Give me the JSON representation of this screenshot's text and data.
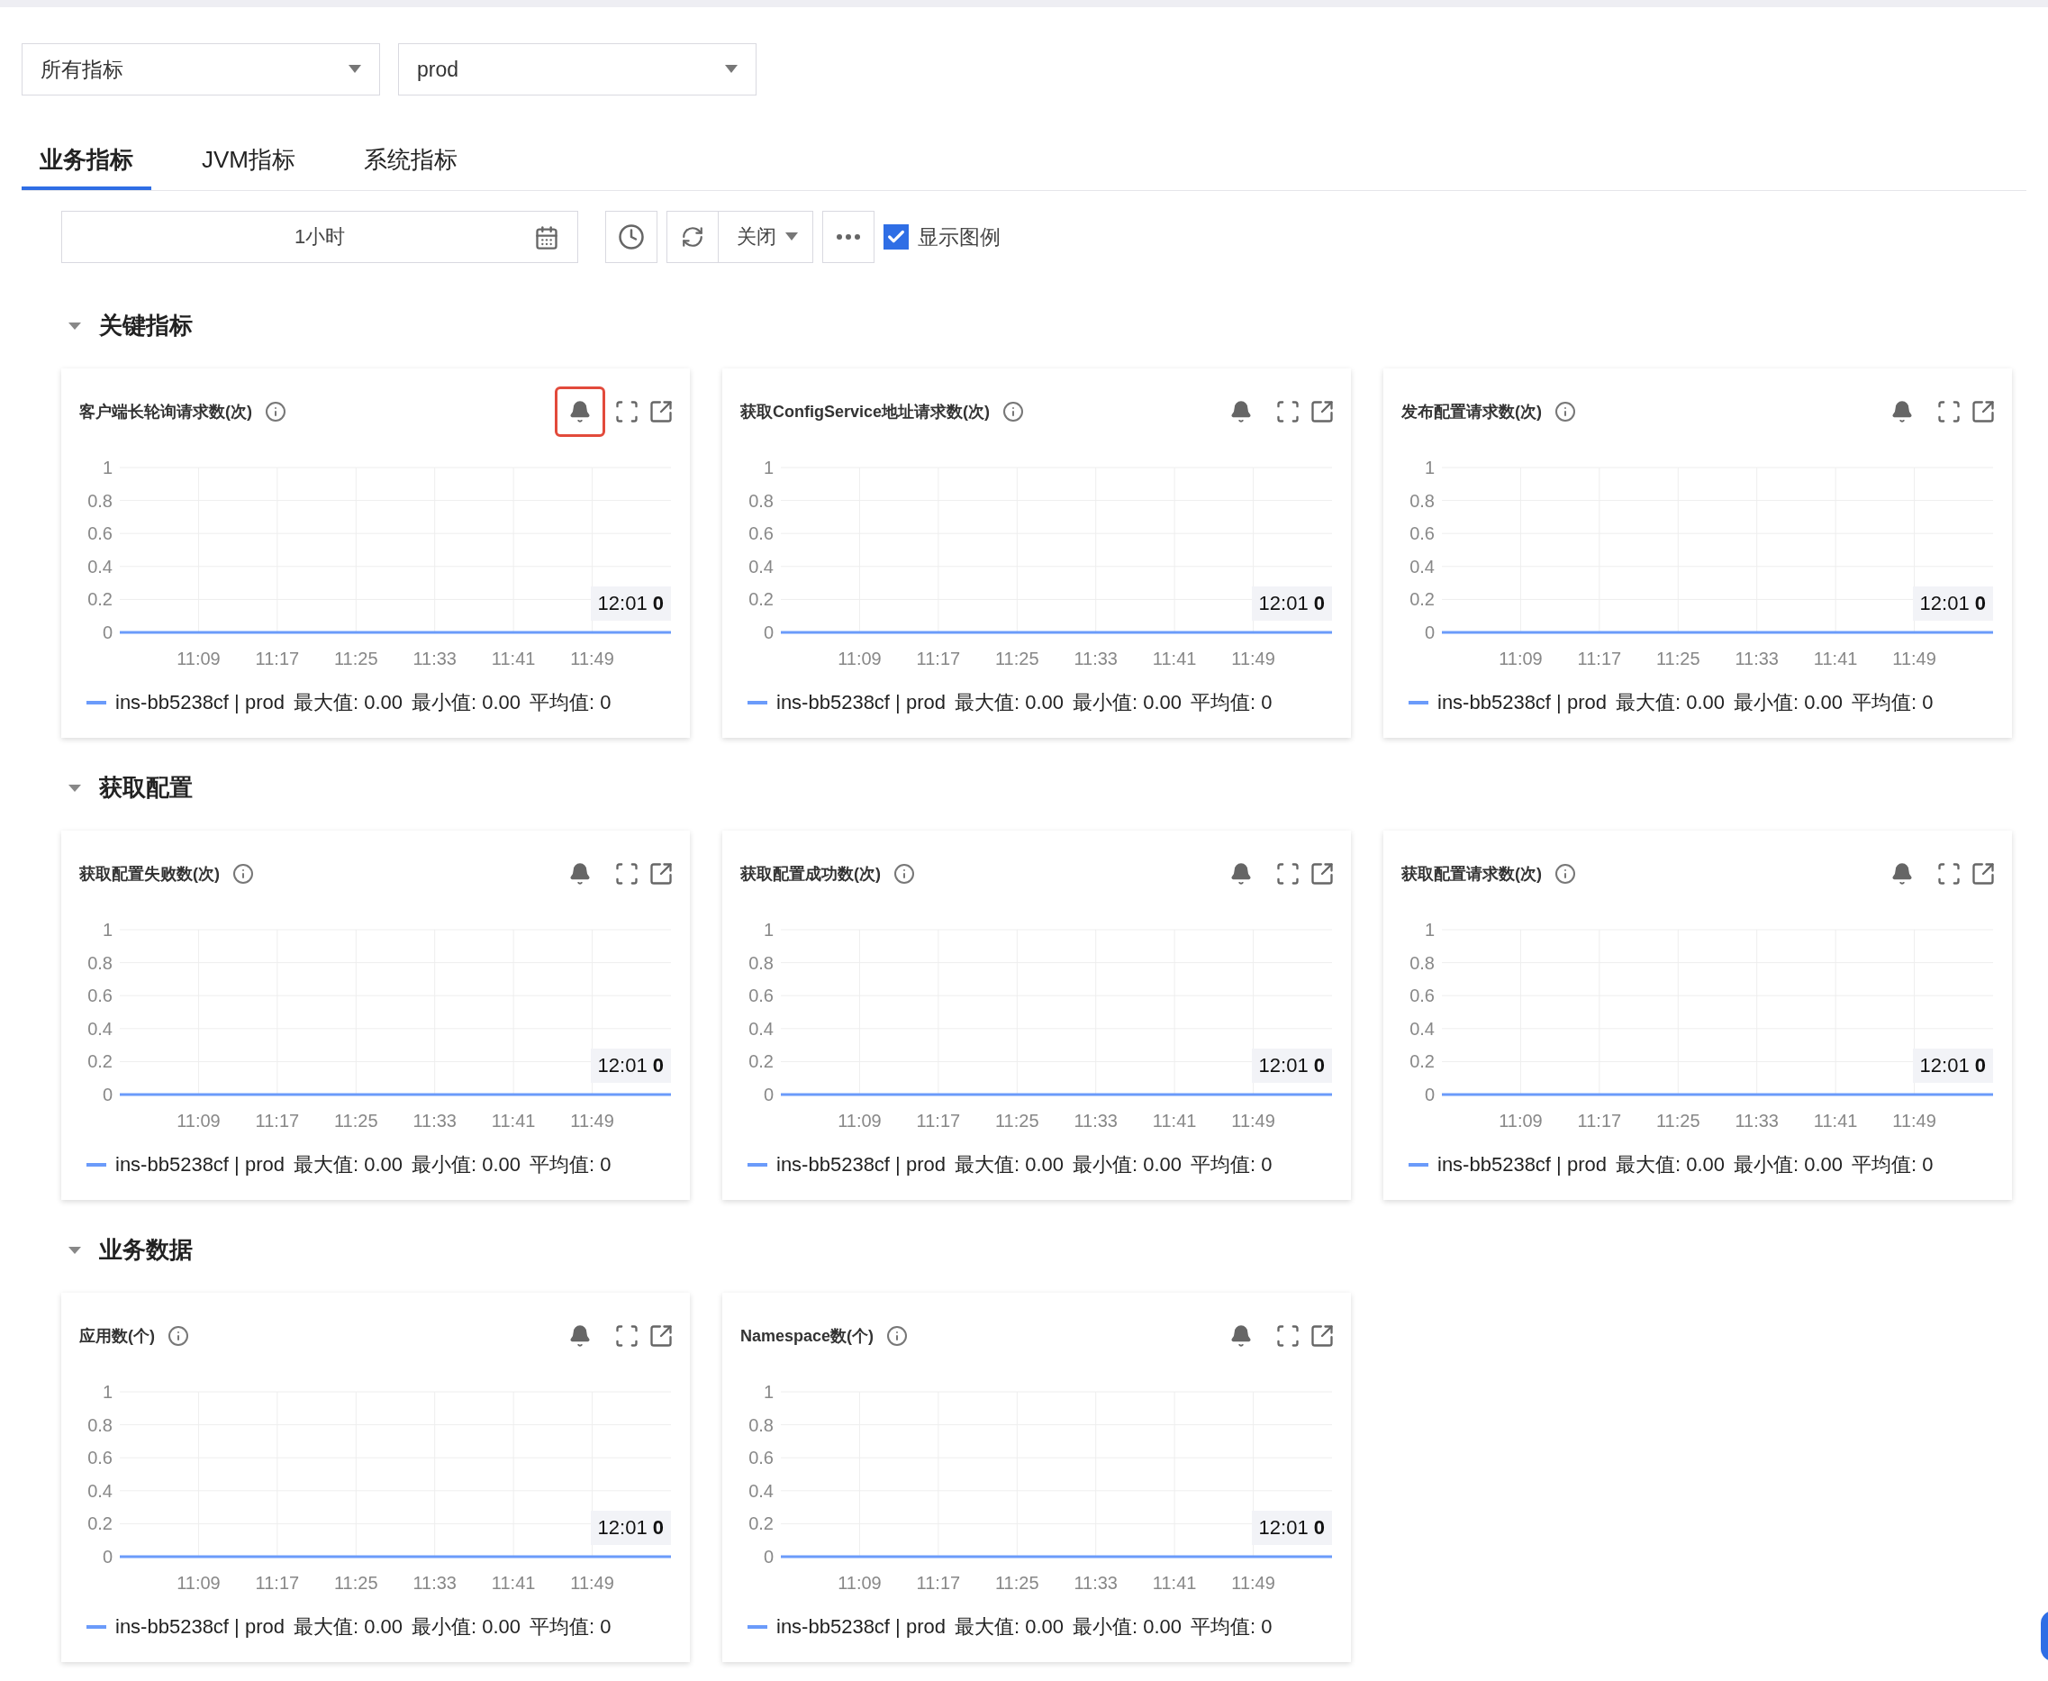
{
  "filters": [
    {
      "value": "所有指标"
    },
    {
      "value": "prod"
    }
  ],
  "tabs": [
    {
      "label": "业务指标",
      "selected": true
    },
    {
      "label": "JVM指标",
      "selected": false
    },
    {
      "label": "系统指标",
      "selected": false
    }
  ],
  "toolbar": {
    "time_range": "1小时",
    "refresh_mode": "关闭",
    "show_legend": {
      "label": "显示图例",
      "checked": true
    }
  },
  "sections": [
    {
      "title": "关键指标",
      "expanded": true,
      "cards": [
        {
          "title": "客户端长轮询请求数(次)",
          "alert_highlighted": true,
          "tooltip": "12:01 **0**",
          "stats": [
            "最大值: 0.00",
            "最小值: 0.00",
            "平均值: 0"
          ],
          "chart_data": {
            "type": "line",
            "grid": true,
            "categories": [
              null,
              "11:09",
              "11:17",
              "11:25",
              "11:33",
              "11:41",
              "11:49",
              null
            ],
            "ylim": [
              0,
              1
            ],
            "yticks": [
              0,
              0.2,
              0.4,
              0.6,
              0.8,
              1
            ],
            "series": [
              {
                "name": "ins-bb5238cf | prod",
                "color": "#6b9bfa",
                "values": [
                  0,
                  0,
                  0,
                  0,
                  0,
                  0,
                  0,
                  0
                ]
              }
            ]
          }
        },
        {
          "title": "获取ConfigService地址请求数(次)",
          "alert_highlighted": false,
          "tooltip": "12:01 **0**",
          "stats": [
            "最大值: 0.00",
            "最小值: 0.00",
            "平均值: 0"
          ],
          "chart_data": {
            "type": "line",
            "grid": true,
            "categories": [
              null,
              "11:09",
              "11:17",
              "11:25",
              "11:33",
              "11:41",
              "11:49",
              null
            ],
            "ylim": [
              0,
              1
            ],
            "yticks": [
              0,
              0.2,
              0.4,
              0.6,
              0.8,
              1
            ],
            "series": [
              {
                "name": "ins-bb5238cf | prod",
                "color": "#6b9bfa",
                "values": [
                  0,
                  0,
                  0,
                  0,
                  0,
                  0,
                  0,
                  0
                ]
              }
            ]
          }
        },
        {
          "title": "发布配置请求数(次)",
          "alert_highlighted": false,
          "tooltip": "12:01 **0**",
          "stats": [
            "最大值: 0.00",
            "最小值: 0.00",
            "平均值: 0"
          ],
          "chart_data": {
            "type": "line",
            "grid": true,
            "categories": [
              null,
              "11:09",
              "11:17",
              "11:25",
              "11:33",
              "11:41",
              "11:49",
              null
            ],
            "ylim": [
              0,
              1
            ],
            "yticks": [
              0,
              0.2,
              0.4,
              0.6,
              0.8,
              1
            ],
            "series": [
              {
                "name": "ins-bb5238cf | prod",
                "color": "#6b9bfa",
                "values": [
                  0,
                  0,
                  0,
                  0,
                  0,
                  0,
                  0,
                  0
                ]
              }
            ]
          }
        }
      ]
    },
    {
      "title": "获取配置",
      "expanded": true,
      "cards": [
        {
          "title": "获取配置失败数(次)",
          "alert_highlighted": false,
          "tooltip": "12:01 **0**",
          "stats": [
            "最大值: 0.00",
            "最小值: 0.00",
            "平均值: 0"
          ],
          "chart_data": {
            "type": "line",
            "grid": true,
            "categories": [
              null,
              "11:09",
              "11:17",
              "11:25",
              "11:33",
              "11:41",
              "11:49",
              null
            ],
            "ylim": [
              0,
              1
            ],
            "yticks": [
              0,
              0.2,
              0.4,
              0.6,
              0.8,
              1
            ],
            "series": [
              {
                "name": "ins-bb5238cf | prod",
                "color": "#6b9bfa",
                "values": [
                  0,
                  0,
                  0,
                  0,
                  0,
                  0,
                  0,
                  0
                ]
              }
            ]
          }
        },
        {
          "title": "获取配置成功数(次)",
          "alert_highlighted": false,
          "tooltip": "12:01 **0**",
          "stats": [
            "最大值: 0.00",
            "最小值: 0.00",
            "平均值: 0"
          ],
          "chart_data": {
            "type": "line",
            "grid": true,
            "categories": [
              null,
              "11:09",
              "11:17",
              "11:25",
              "11:33",
              "11:41",
              "11:49",
              null
            ],
            "ylim": [
              0,
              1
            ],
            "yticks": [
              0,
              0.2,
              0.4,
              0.6,
              0.8,
              1
            ],
            "series": [
              {
                "name": "ins-bb5238cf | prod",
                "color": "#6b9bfa",
                "values": [
                  0,
                  0,
                  0,
                  0,
                  0,
                  0,
                  0,
                  0
                ]
              }
            ]
          }
        },
        {
          "title": "获取配置请求数(次)",
          "alert_highlighted": false,
          "tooltip": "12:01 **0**",
          "stats": [
            "最大值: 0.00",
            "最小值: 0.00",
            "平均值: 0"
          ],
          "chart_data": {
            "type": "line",
            "grid": true,
            "categories": [
              null,
              "11:09",
              "11:17",
              "11:25",
              "11:33",
              "11:41",
              "11:49",
              null
            ],
            "ylim": [
              0,
              1
            ],
            "yticks": [
              0,
              0.2,
              0.4,
              0.6,
              0.8,
              1
            ],
            "series": [
              {
                "name": "ins-bb5238cf | prod",
                "color": "#6b9bfa",
                "values": [
                  0,
                  0,
                  0,
                  0,
                  0,
                  0,
                  0,
                  0
                ]
              }
            ]
          }
        }
      ]
    },
    {
      "title": "业务数据",
      "expanded": true,
      "cards": [
        {
          "title": "应用数(个)",
          "alert_highlighted": false,
          "tooltip": "12:01 **0**",
          "stats": [
            "最大值: 0.00",
            "最小值: 0.00",
            "平均值: 0"
          ],
          "chart_data": {
            "type": "line",
            "grid": true,
            "categories": [
              null,
              "11:09",
              "11:17",
              "11:25",
              "11:33",
              "11:41",
              "11:49",
              null
            ],
            "ylim": [
              0,
              1
            ],
            "yticks": [
              0,
              0.2,
              0.4,
              0.6,
              0.8,
              1
            ],
            "series": [
              {
                "name": "ins-bb5238cf | prod",
                "color": "#6b9bfa",
                "values": [
                  0,
                  0,
                  0,
                  0,
                  0,
                  0,
                  0,
                  0
                ]
              }
            ]
          }
        },
        {
          "title": "Namespace数(个)",
          "alert_highlighted": false,
          "tooltip": "12:01 **0**",
          "stats": [
            "最大值: 0.00",
            "最小值: 0.00",
            "平均值: 0"
          ],
          "chart_data": {
            "type": "line",
            "grid": true,
            "categories": [
              null,
              "11:09",
              "11:17",
              "11:25",
              "11:33",
              "11:41",
              "11:49",
              null
            ],
            "ylim": [
              0,
              1
            ],
            "yticks": [
              0,
              0.2,
              0.4,
              0.6,
              0.8,
              1
            ],
            "series": [
              {
                "name": "ins-bb5238cf | prod",
                "color": "#6b9bfa",
                "values": [
                  0,
                  0,
                  0,
                  0,
                  0,
                  0,
                  0,
                  0
                ]
              }
            ]
          }
        }
      ]
    }
  ]
}
